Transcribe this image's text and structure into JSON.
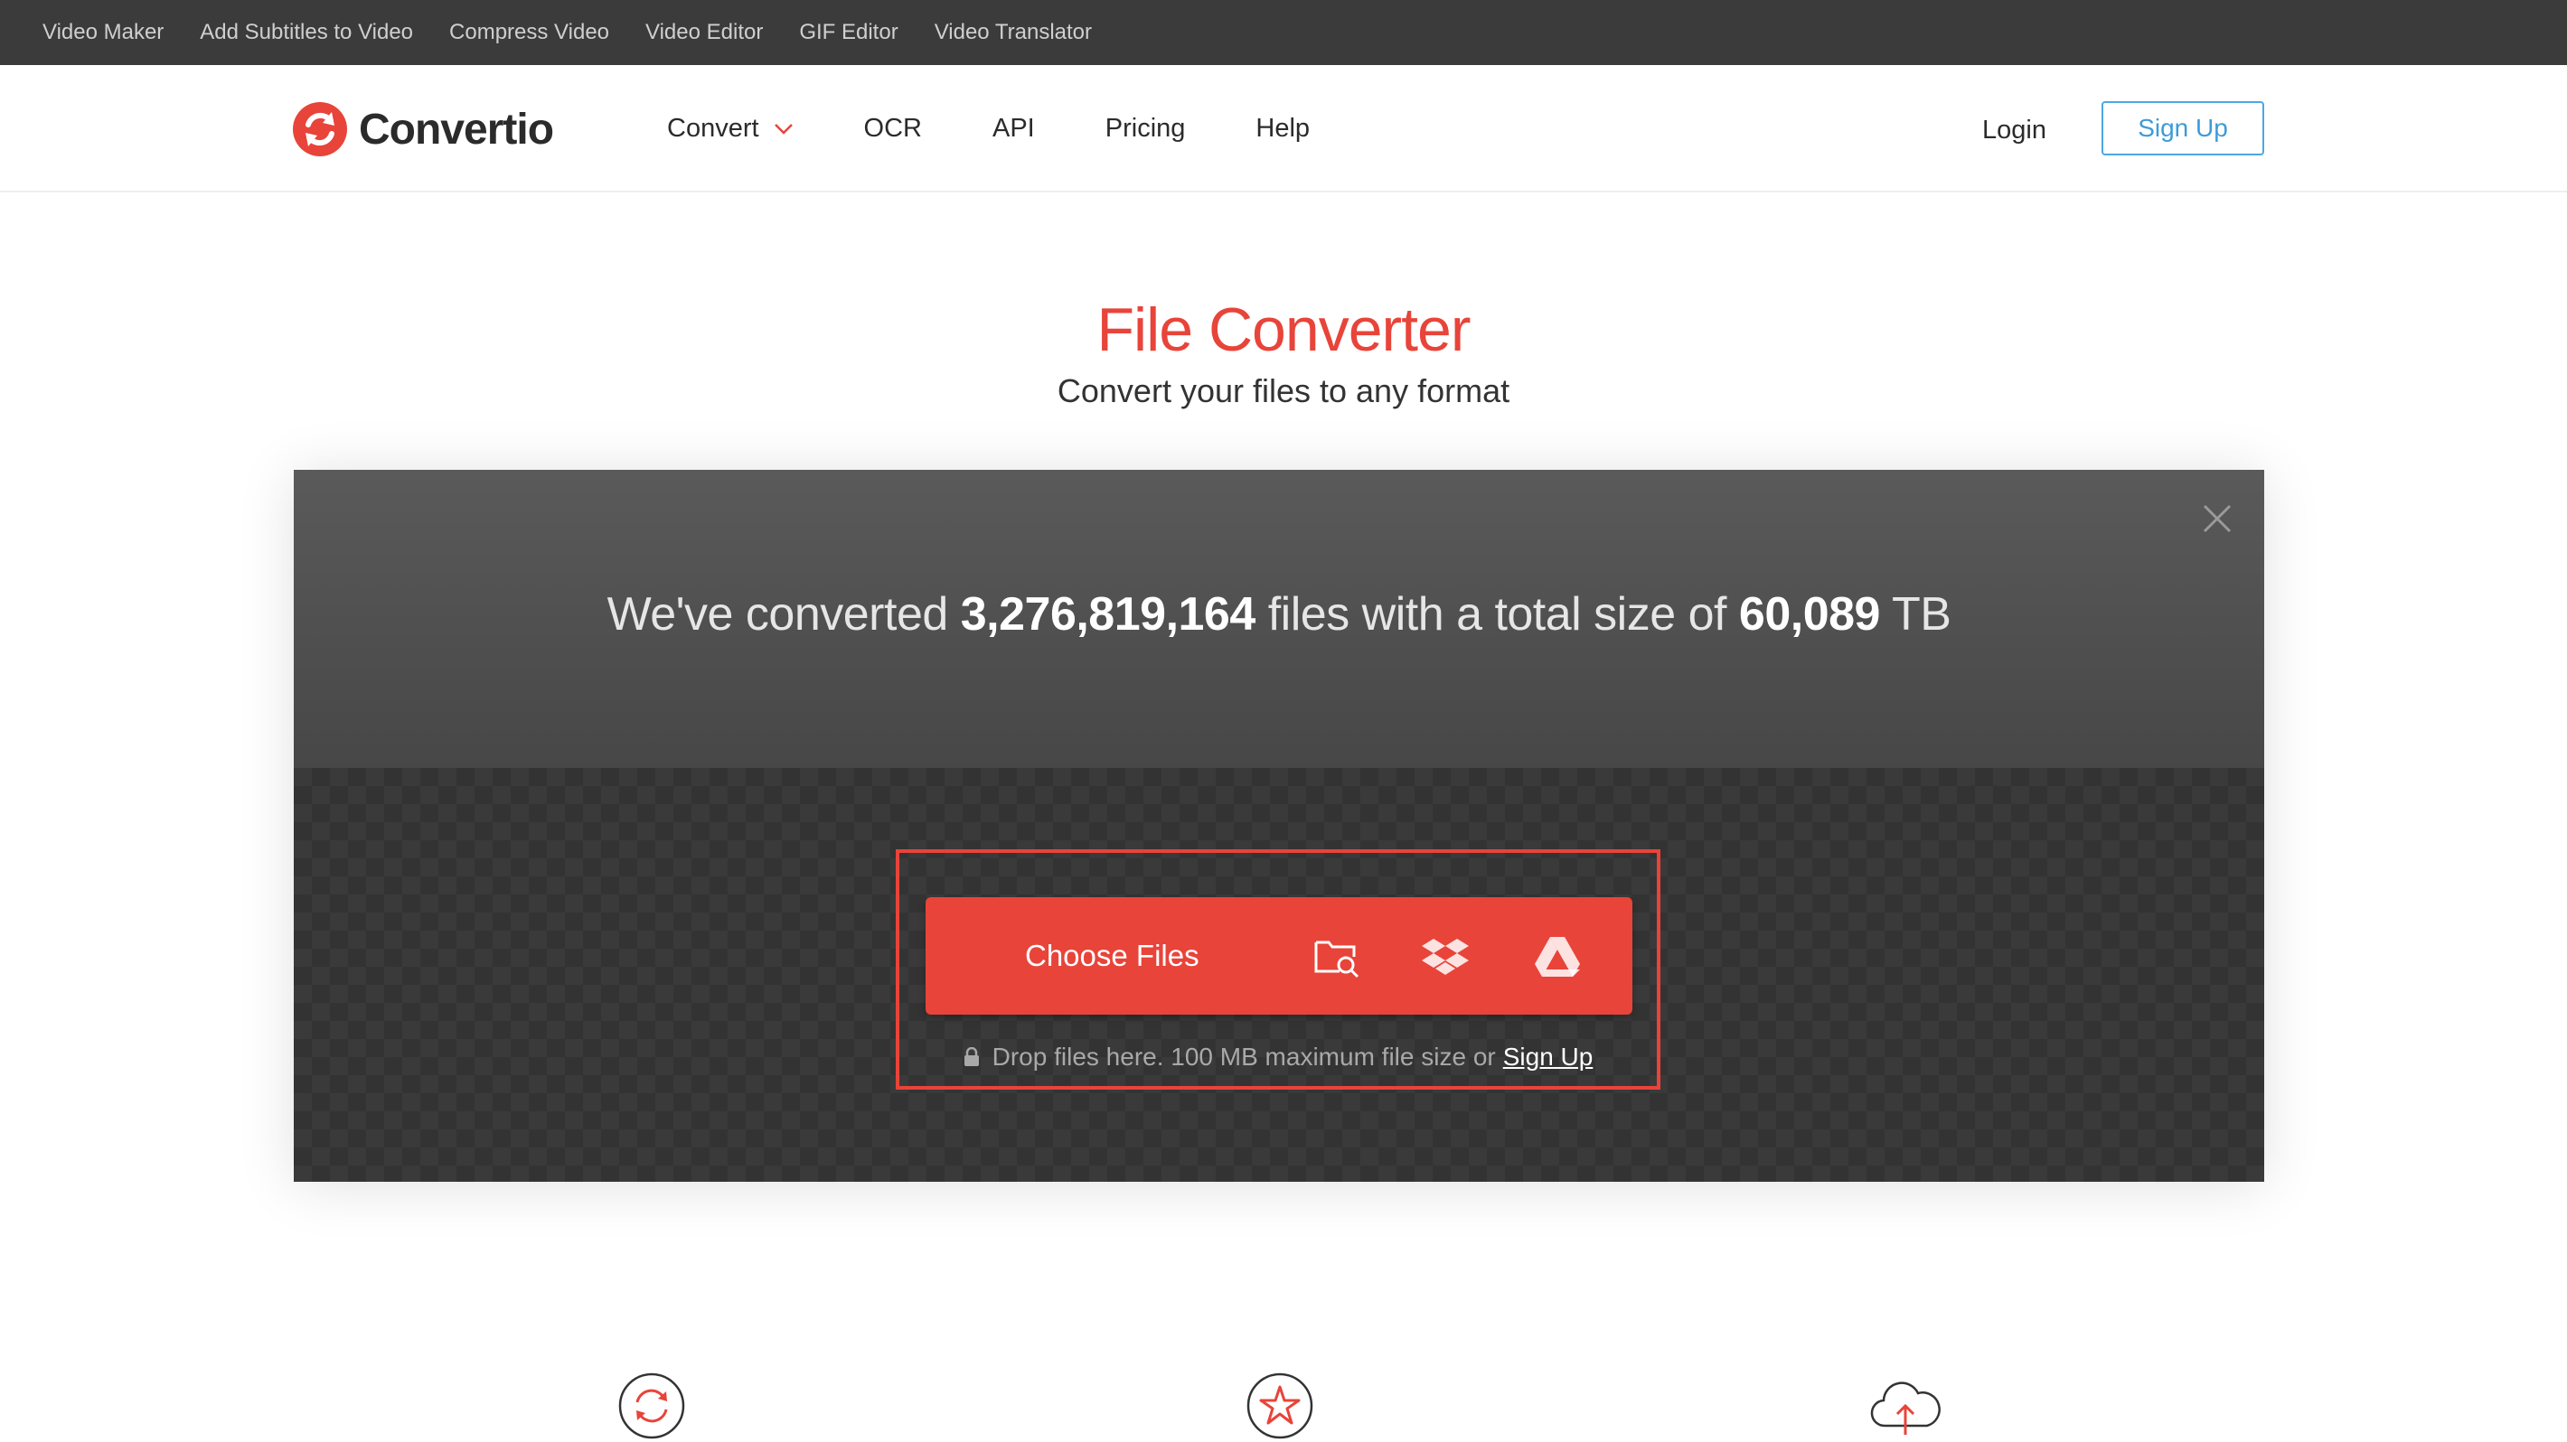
{
  "topbar": {
    "links": [
      "Video Maker",
      "Add Subtitles to Video",
      "Compress Video",
      "Video Editor",
      "GIF Editor",
      "Video Translator"
    ]
  },
  "brand": {
    "name": "Convertio",
    "accent": "#e8443a",
    "link_blue": "#3d9bd9"
  },
  "nav": {
    "items": [
      "Convert",
      "OCR",
      "API",
      "Pricing",
      "Help"
    ],
    "login": "Login",
    "signup": "Sign Up"
  },
  "hero": {
    "title": "File Converter",
    "subtitle": "Convert your files to any format"
  },
  "stats": {
    "prefix": "We've converted",
    "files": "3,276,819,164",
    "middle": "files with a total size of",
    "size": "60,089",
    "unit": "TB"
  },
  "uploader": {
    "button": "Choose Files",
    "sources": [
      "folder-search-icon",
      "dropbox-icon",
      "google-drive-icon"
    ],
    "note": "Drop files here. 100 MB maximum file size or",
    "note_link": "Sign Up"
  },
  "features": [
    "refresh-icon",
    "star-icon",
    "cloud-upload-icon"
  ]
}
